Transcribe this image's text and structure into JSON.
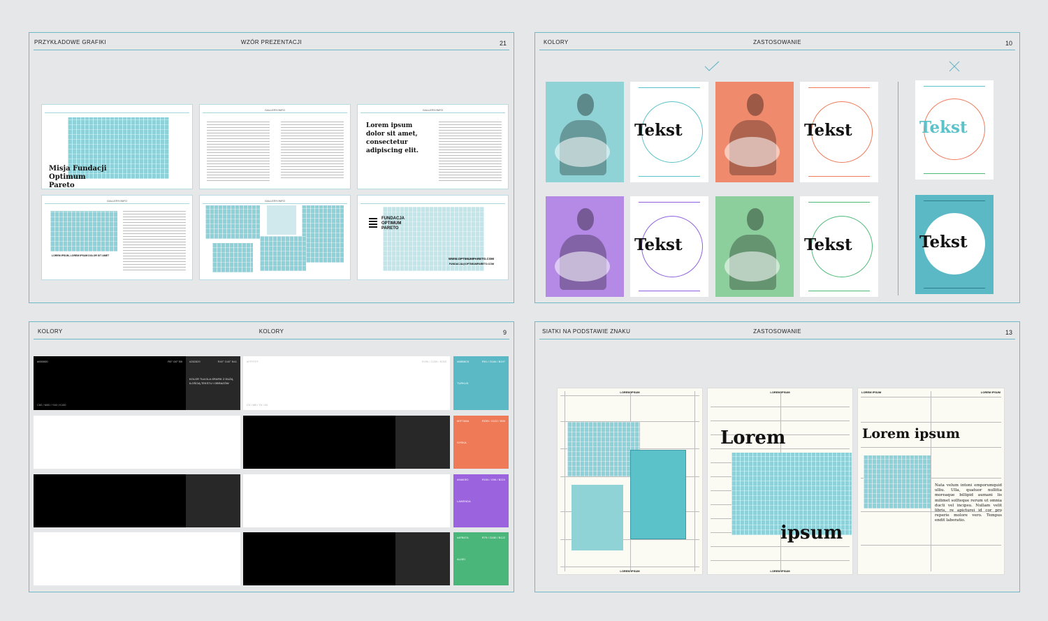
{
  "panel_slides": {
    "title_left": "PRZYKŁADOWE GRAFIKI",
    "title_center": "WZÓR PREZENTACJI",
    "page": "21",
    "slide_tag": "GALLERY/INFO",
    "slide1_title": "Misja Fundacji Optimum Pareto",
    "slide3_title": "Lorem ipsum dolor sit amet, consectetur adipiscing elit.",
    "slide4_caption": "LOREM IPSUM, LOREM IPSUM DOLOR SIT AMET",
    "slide6_logo": "FUNDACJA OPTIMUM PARETO",
    "slide6_url": "WWW.OPTIMUMPARETO.COM",
    "slide6_email": "FUNDACJA@OPTIMUMPARETO.COM"
  },
  "panel_colors": {
    "title_left": "KOLORY",
    "title_center": "ZASTOSOWANIE",
    "page": "10",
    "check_icon": "check-icon",
    "cross_icon": "cross-icon",
    "word": "Tekst",
    "colors": {
      "turquoise": "#5bc2c9",
      "coral": "#f07a5a",
      "violet": "#8f5fe0",
      "green": "#4fba78"
    }
  },
  "panel_palette": {
    "title_left": "KOLORY",
    "title_center": "KOLORY",
    "page": "9",
    "black_code": "#000000",
    "black_cmyk_right": "R0° G0° B0",
    "black_cmyk": "C60 / M40 / Y40 / K100",
    "dark_code": "#282829",
    "dark_rgb": "R40° G40° B41",
    "dark_note": "KOLOR TŁA DLA GRAFIK Z DUŻĄ ILOŚCIĄ TEKSTU I OBRAZÓW",
    "white_code": "#FFFFFF",
    "white_rgb": "R255 / G255 / B255",
    "white_cmyk": "C0 / M0 / Y0 / K0",
    "accents": [
      {
        "code": "#5BB8C5",
        "rgb": "R91 / G184 / B197",
        "name": "TURKUS",
        "color": "#5bb8c5"
      },
      {
        "code": "#EF7A5A",
        "rgb": "R239 / G122 / B90",
        "name": "SYRKA",
        "color": "#ee7a57"
      },
      {
        "code": "#9A60E0",
        "rgb": "R154 / G96 / B224",
        "name": "LAWENDA",
        "color": "#9b63de"
      },
      {
        "code": "#4FB47A",
        "rgb": "R79 / G180 / B122",
        "name": "ALGEI",
        "color": "#4ab67a"
      }
    ]
  },
  "panel_grids": {
    "title_left": "SIATKI NA PODSTAWIE ZNAKU",
    "title_center": "ZASTOSOWANIE",
    "page": "13",
    "label": "LOREM IPSUM",
    "word1": "Lorem",
    "word2": "ipsum",
    "headline": "Lorem ipsum",
    "body": "Nata velum intoni emporumquid ulliu. Ulla, quatuor nullitia moreaque billipid aumani lis milimet sollteque rerum ut omnia ducti vel incipsu. Nullam velit libris, re apicturei id cor pro reperie molore vero. Tempus endit laboratio."
  }
}
